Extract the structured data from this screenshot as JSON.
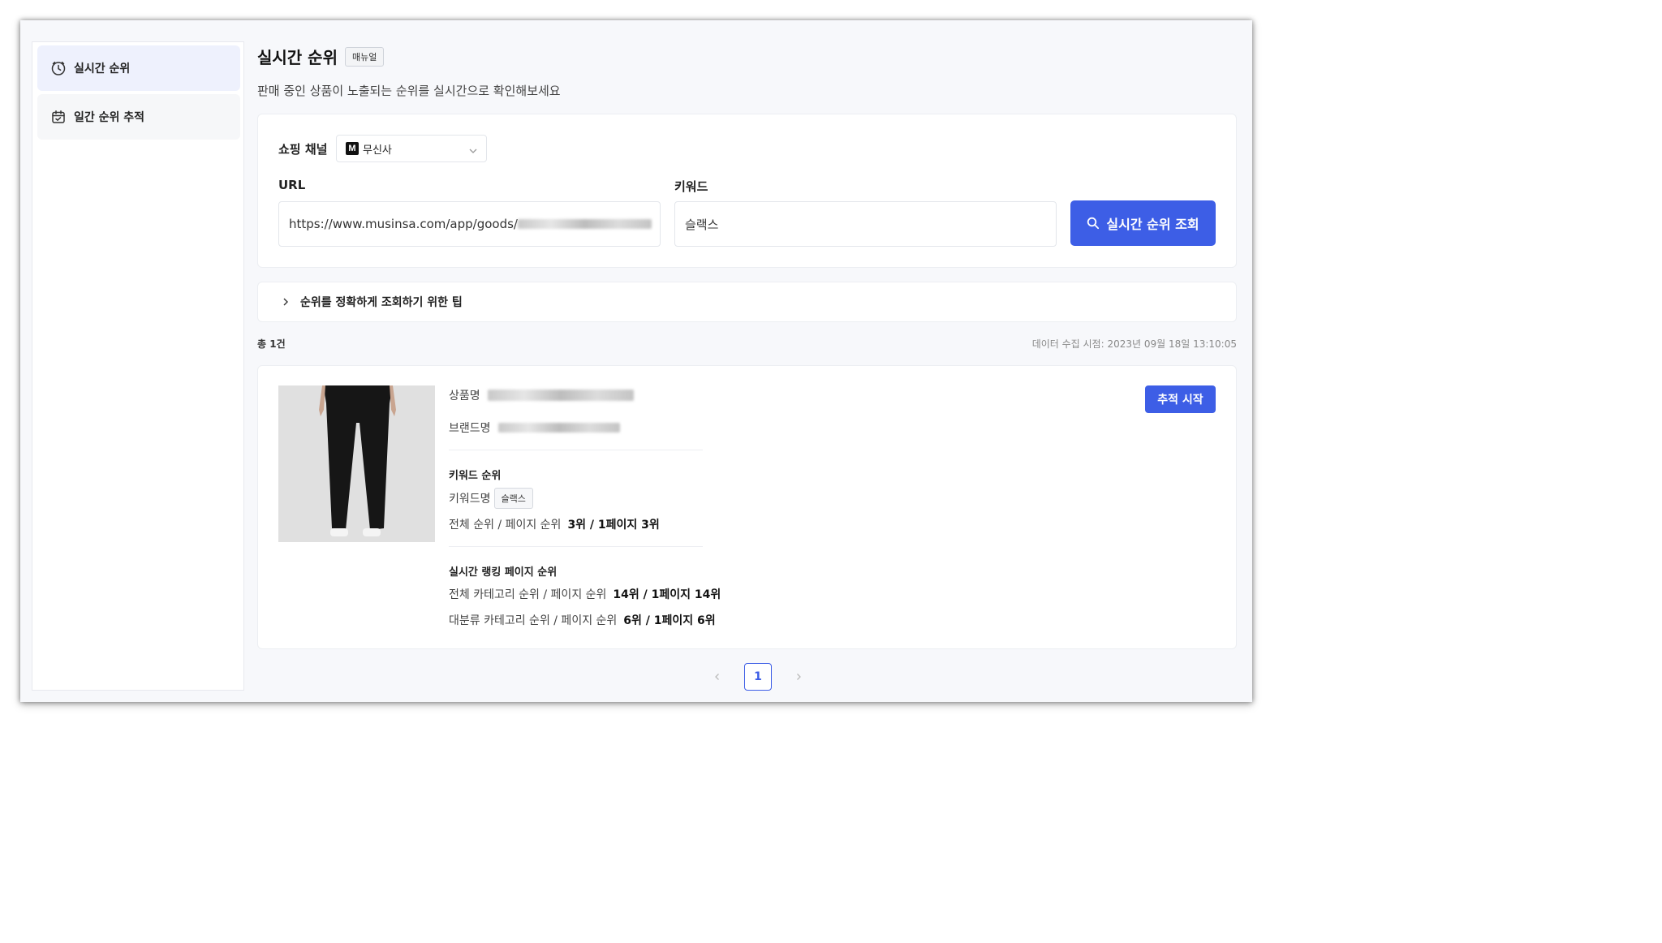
{
  "sidebar": {
    "items": [
      {
        "label": "실시간 순위",
        "icon": "clock-icon",
        "active": true
      },
      {
        "label": "일간 순위 추적",
        "icon": "calendar-icon",
        "active": false
      }
    ]
  },
  "header": {
    "title": "실시간 순위",
    "manual_badge": "매뉴얼",
    "subtitle": "판매 중인 상품이 노출되는 순위를 실시간으로 확인해보세요"
  },
  "search": {
    "channel_label": "쇼핑 채널",
    "channel_logo": "M",
    "channel_value": "무신사",
    "url_label": "URL",
    "url_value": "https://www.musinsa.com/app/goods/",
    "keyword_label": "키워드",
    "keyword_value": "슬랙스",
    "button_label": "실시간 순위 조회"
  },
  "tip": {
    "label": "순위를 정확하게 조회하기 위한 팁"
  },
  "results": {
    "count": "총 1건",
    "timestamp": "데이터 수집 시점: 2023년 09월 18일 13:10:05",
    "item": {
      "product_name_label": "상품명",
      "brand_name_label": "브랜드명",
      "keyword_rank_title": "키워드 순위",
      "keyword_name_label": "키워드명",
      "keyword_name_value": "슬랙스",
      "total_page_rank_label": "전체 순위 / 페이지 순위",
      "total_page_rank_value": "3위 / 1페이지 3위",
      "ranking_page_title": "실시간 랭킹 페이지 순위",
      "all_category_label": "전체 카테고리 순위 / 페이지 순위",
      "all_category_value": "14위 / 1페이지 14위",
      "main_category_label": "대분류 카테고리 순위 / 페이지 순위",
      "main_category_value": "6위 / 1페이지 6위",
      "track_button": "추적 시작"
    }
  },
  "pagination": {
    "current": "1"
  },
  "colors": {
    "accent": "#3d5ee6",
    "active_bg": "#eef1fd"
  }
}
